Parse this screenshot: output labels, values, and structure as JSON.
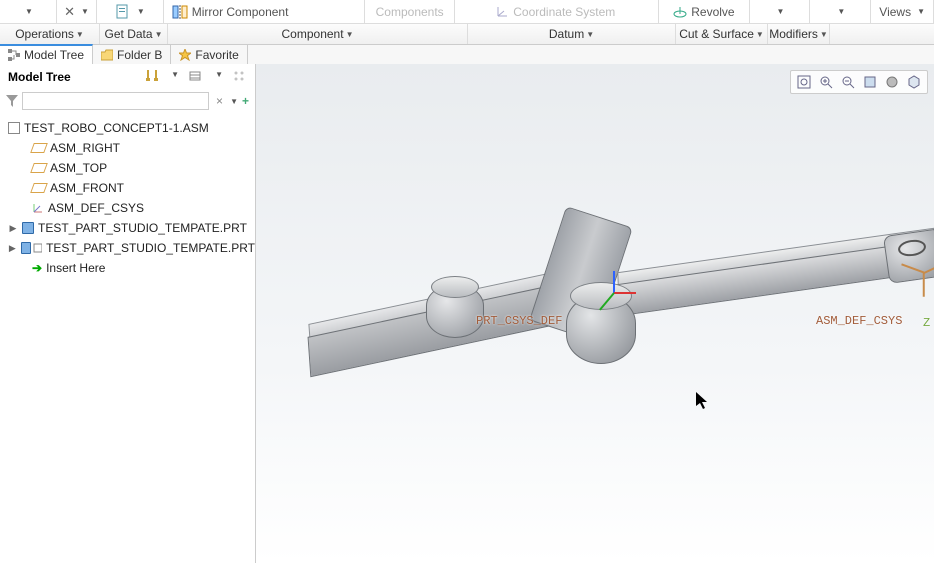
{
  "ribbon": {
    "row1": {
      "mirror_component": "Mirror Component",
      "components": "Components",
      "coordinate_system": "Coordinate System",
      "revolve": "Revolve",
      "views": "Views"
    },
    "row2": {
      "operations": "Operations",
      "get_data": "Get Data",
      "component": "Component",
      "datum": "Datum",
      "cut_surface": "Cut & Surface",
      "modifiers": "Modifiers"
    }
  },
  "panel_tabs": {
    "model_tree": "Model Tree",
    "folder": "Folder B",
    "favorite": "Favorite"
  },
  "sidebar": {
    "title": "Model Tree",
    "filter_value": "",
    "filter_placeholder": ""
  },
  "tree": {
    "root": "TEST_ROBO_CONCEPT1-1.ASM",
    "items": [
      {
        "label": "ASM_RIGHT",
        "kind": "plane"
      },
      {
        "label": "ASM_TOP",
        "kind": "plane"
      },
      {
        "label": "ASM_FRONT",
        "kind": "plane"
      },
      {
        "label": "ASM_DEF_CSYS",
        "kind": "csys"
      },
      {
        "label": "TEST_PART_STUDIO_TEMPATE.PRT",
        "kind": "part",
        "expandable": true
      },
      {
        "label": "TEST_PART_STUDIO_TEMPATE.PRT",
        "kind": "part",
        "expandable": true
      },
      {
        "label": "Insert Here",
        "kind": "insert"
      }
    ]
  },
  "canvas": {
    "labels": {
      "left_csys": "PRT_CSYS_DEF",
      "right_csys": "ASM_DEF_CSYS",
      "z": "Z"
    }
  }
}
